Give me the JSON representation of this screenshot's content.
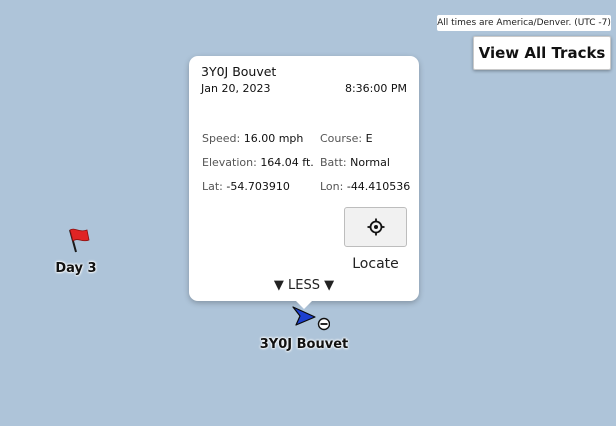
{
  "map": {
    "timezone_note": "All times are America/Denver. (UTC -7)",
    "view_all_tracks_label": "View All Tracks",
    "water_color": "#aec4d9"
  },
  "waypoint": {
    "label": "Day 3",
    "icon": "red-flag-icon",
    "color": "#e02424"
  },
  "track": {
    "label": "3Y0J Bouvet",
    "icon": "blue-arrow-icon",
    "color": "#1c3fcf"
  },
  "popup": {
    "name": "3Y0J Bouvet",
    "date": "Jan 20, 2023",
    "time": "8:36:00 PM",
    "speed_label": "Speed:",
    "speed_value": "16.00 mph",
    "course_label": "Course:",
    "course_value": "E",
    "elevation_label": "Elevation:",
    "elevation_value": "164.04 ft.",
    "batt_label": "Batt:",
    "batt_value": "Normal",
    "lat_label": "Lat:",
    "lat_value": "-54.703910",
    "lon_label": "Lon:",
    "lon_value": "-44.410536",
    "locate_label": "Locate",
    "locate_icon": "crosshair-icon",
    "less_label": "▼ LESS ▼"
  }
}
